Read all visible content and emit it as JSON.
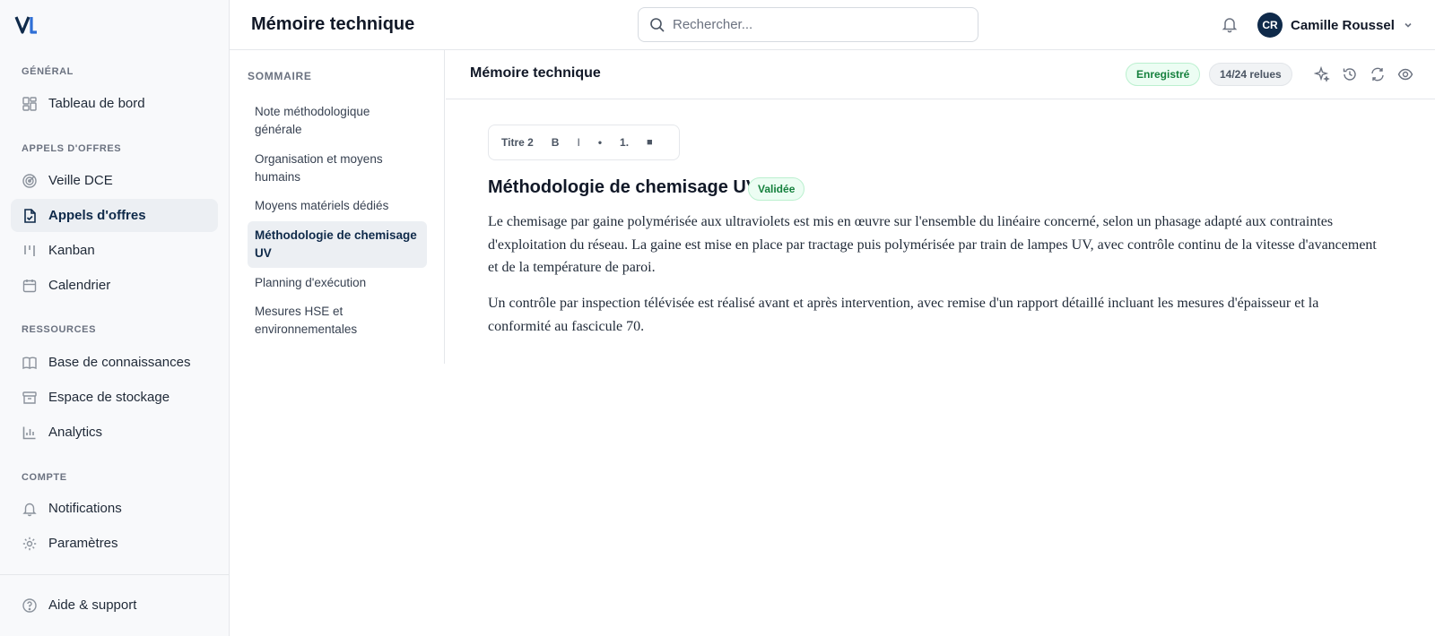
{
  "sidebar": {
    "sections": [
      {
        "title": "Général",
        "items": [
          {
            "label": "Tableau de bord",
            "icon": "dashboard-icon"
          }
        ]
      },
      {
        "title": "Appels d'offres",
        "items": [
          {
            "label": "Veille DCE",
            "icon": "radar-icon"
          },
          {
            "label": "Appels d'offres",
            "icon": "document-icon",
            "active": true
          },
          {
            "label": "Kanban",
            "icon": "kanban-icon"
          },
          {
            "label": "Calendrier",
            "icon": "calendar-icon"
          }
        ]
      },
      {
        "title": "Ressources",
        "items": [
          {
            "label": "Base de connaissances",
            "icon": "book-icon"
          },
          {
            "label": "Espace de stockage",
            "icon": "archive-icon"
          },
          {
            "label": "Analytics",
            "icon": "chart-icon"
          }
        ]
      },
      {
        "title": "Compte",
        "items": [
          {
            "label": "Notifications",
            "icon": "bell-icon"
          },
          {
            "label": "Paramètres",
            "icon": "gear-icon"
          }
        ]
      }
    ],
    "footer": {
      "label": "Aide & support",
      "icon": "help-icon"
    }
  },
  "header": {
    "title": "Mémoire technique",
    "search_placeholder": "Rechercher...",
    "user": {
      "initials": "CR",
      "name": "Camille Roussel"
    }
  },
  "toc": {
    "title": "SOMMAIRE",
    "items": [
      {
        "label": "Note méthodologique générale"
      },
      {
        "label": "Organisation et moyens humains"
      },
      {
        "label": "Moyens matériels dédiés"
      },
      {
        "label": "Méthodologie de chemisage UV",
        "active": true
      },
      {
        "label": "Planning d'exécution"
      },
      {
        "label": "Mesures HSE et environnementales"
      }
    ]
  },
  "document": {
    "title": "Mémoire technique",
    "status": "Enregistré",
    "review_count": "14/24 relues",
    "toolbar": {
      "heading": "Titre 2",
      "bold": "B",
      "italic": "I",
      "bullet": "•",
      "numbered": "1.",
      "block": "■"
    },
    "section": {
      "title": "Méthodologie de chemisage UV",
      "status": "Validée",
      "paragraphs": [
        "Le chemisage par gaine polymérisée aux ultraviolets est mis en œuvre sur l'ensemble du linéaire concerné, selon un phasage adapté aux contraintes d'exploitation du réseau. La gaine est mise en place par tractage puis polymérisée par train de lampes UV, avec contrôle continu de la vitesse d'avancement et de la température de paroi.",
        "Un contrôle par inspection télévisée est réalisé avant et après intervention, avec remise d'un rapport détaillé incluant les mesures d'épaisseur et la conformité au fascicule 70."
      ]
    }
  },
  "colors": {
    "brand": "#0f2a4a",
    "success": "#15803d",
    "sidebar_bg": "#f8f9fb"
  }
}
